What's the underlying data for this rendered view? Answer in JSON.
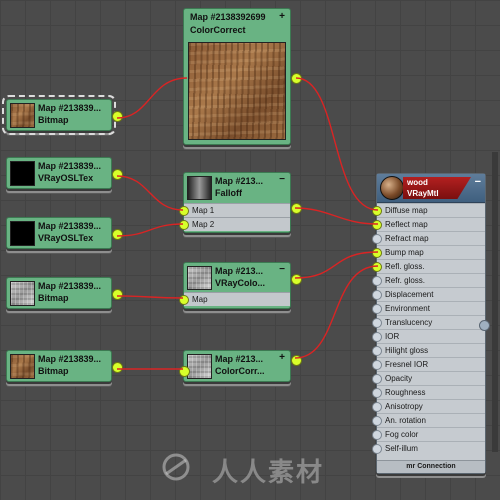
{
  "nodes": {
    "bitmap1": {
      "title": "Map #213839...",
      "type": "Bitmap"
    },
    "vrayosl1": {
      "title": "Map #213839...",
      "type": "VRayOSLTex"
    },
    "vrayosl2": {
      "title": "Map #213839...",
      "type": "VRayOSLTex"
    },
    "bitmap2": {
      "title": "Map #213839...",
      "type": "Bitmap"
    },
    "bitmap3": {
      "title": "Map #213839...",
      "type": "Bitmap"
    },
    "colorcorrect_top": {
      "title": "Map #2138392699",
      "type": "ColorCorrect",
      "toggle": "+"
    },
    "falloff": {
      "title": "Map #213...",
      "type": "Falloff",
      "toggle": "−",
      "slots": [
        "Map 1",
        "Map 2"
      ]
    },
    "vraycolor": {
      "title": "Map #213...",
      "type": "VRayColo...",
      "toggle": "−",
      "slots": [
        "Map"
      ]
    },
    "colorcorrect_bottom": {
      "title": "Map #213...",
      "type": "ColorCorr...",
      "toggle": "+"
    }
  },
  "material": {
    "name": "wood",
    "type": "VRayMtl",
    "toggle": "−",
    "slots": [
      "Diffuse map",
      "Reflect map",
      "Refract map",
      "Bump map",
      "Refl. gloss.",
      "Refr. gloss.",
      "Displacement",
      "Environment",
      "Translucency",
      "IOR",
      "Hilight gloss",
      "Fresnel IOR",
      "Opacity",
      "Roughness",
      "Anisotropy",
      "An. rotation",
      "Fog color",
      "Self-illum"
    ],
    "connected_slots": [
      "Diffuse map",
      "Reflect map",
      "Bump map",
      "Refl. gloss."
    ],
    "footer": "mr Connection"
  },
  "watermark": {
    "text": "人人素材"
  },
  "colors": {
    "node_green": "#69b383",
    "socket": "#d8ff2a",
    "wire": "#d92424",
    "grid_bg": "#4b4b4b"
  }
}
